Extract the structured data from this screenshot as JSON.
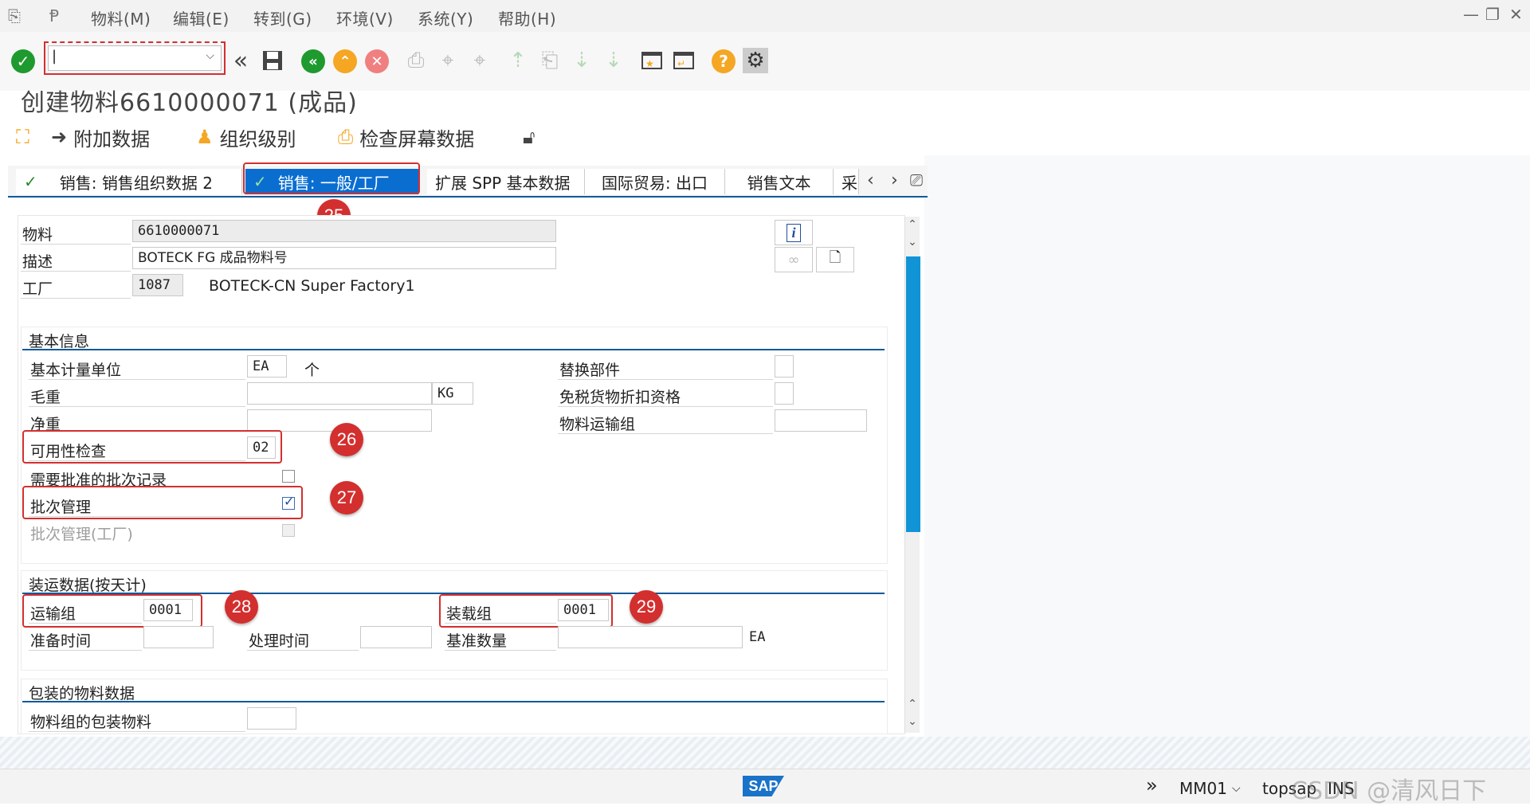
{
  "menubar": {
    "items": [
      "物料(M)",
      "编辑(E)",
      "转到(G)",
      "环境(V)",
      "系统(Y)",
      "帮助(H)"
    ],
    "window_controls": [
      "—",
      "❐",
      "✕"
    ]
  },
  "toolbar": {
    "command_value": "|"
  },
  "title": "创建物料6610000071 (成品)",
  "app_toolbar": {
    "additional_data": "附加数据",
    "org_levels": "组织级别",
    "check_screen_data": "检查屏幕数据"
  },
  "tabs": [
    {
      "label": "销售: 销售组织数据 2"
    },
    {
      "label": "销售: 一般/工厂",
      "active": true
    },
    {
      "label": "扩展 SPP 基本数据"
    },
    {
      "label": "国际贸易: 出口"
    },
    {
      "label": "销售文本"
    },
    {
      "label": "采"
    }
  ],
  "header": {
    "material_label": "物料",
    "material_value": "6610000071",
    "desc_label": "描述",
    "desc_value": "BOTECK FG 成品物料号",
    "plant_label": "工厂",
    "plant_value": "1087",
    "plant_name": "BOTECK-CN Super Factory1"
  },
  "basic": {
    "title": "基本信息",
    "base_uom_label": "基本计量单位",
    "base_uom_value": "EA",
    "base_uom_text": "个",
    "gross_weight_label": "毛重",
    "gross_weight_value": "",
    "weight_unit": "KG",
    "net_weight_label": "净重",
    "net_weight_value": "",
    "availability_label": "可用性检查",
    "availability_value": "02",
    "batch_approval_label": "需要批准的批次记录",
    "batch_approval_checked": false,
    "batch_mgmt_label": "批次管理",
    "batch_mgmt_checked": true,
    "batch_mgmt_plant_label": "批次管理(工厂)",
    "batch_mgmt_plant_checked": false,
    "replacement_part_label": "替换部件",
    "duty_free_label": "免税货物折扣资格",
    "mat_freight_group_label": "物料运输组"
  },
  "shipping": {
    "title": "装运数据(按天计)",
    "trans_group_label": "运输组",
    "trans_group_value": "0001",
    "loading_group_label": "装载组",
    "loading_group_value": "0001",
    "setup_time_label": "准备时间",
    "proc_time_label": "处理时间",
    "base_qty_label": "基准数量",
    "base_qty_unit": "EA"
  },
  "packaging": {
    "title": "包装的物料数据",
    "mat_group_pack_label": "物料组的包装物料"
  },
  "badges": [
    "25",
    "26",
    "27",
    "28",
    "29"
  ],
  "status": {
    "sap_logo": "SAP",
    "tcode": "MM01",
    "server": "topsap",
    "mode": "INS",
    "watermark": "CSDN @清风日下"
  },
  "colors": {
    "accent": "#0a6ed1",
    "highlight": "#d32f2f"
  }
}
